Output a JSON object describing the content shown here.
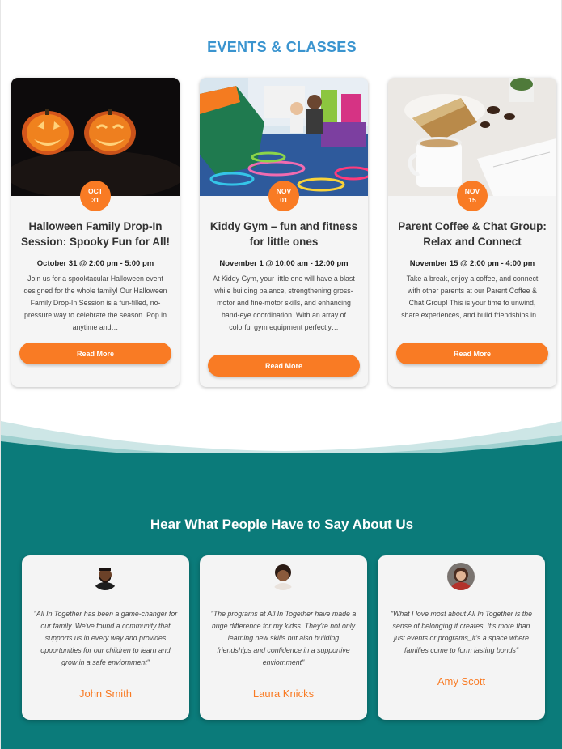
{
  "events": {
    "title": "EVENTS & CLASSES",
    "read_more_label": "Read More",
    "items": [
      {
        "month": "OCT",
        "day": "31",
        "name": "Halloween Family Drop-In Session: Spooky Fun for All!",
        "when": "October 31 @ 2:00 pm - 5:00 pm",
        "desc": "Join us for a spooktacular Halloween event designed for the whole family! Our Halloween Family Drop-In Session is a fun-filled, no-pressure way to celebrate the season. Pop in anytime and…"
      },
      {
        "month": "NOV",
        "day": "01",
        "name": "Kiddy Gym – fun and fitness for little ones",
        "when": "November 1 @ 10:00 am - 12:00 pm",
        "desc": "At Kiddy Gym, your little one will have a blast while building balance, strengthening gross-motor and fine-motor skills, and enhancing hand-eye coordination. With an array of colorful gym equipment perfectly…"
      },
      {
        "month": "NOV",
        "day": "15",
        "name": "Parent Coffee & Chat Group: Relax and Connect",
        "when": "November 15 @ 2:00 pm - 4:00 pm",
        "desc": "Take a break, enjoy a coffee, and connect with other parents at our Parent Coffee & Chat Group! This is your time to unwind, share experiences, and build friendships in…"
      }
    ]
  },
  "testimonials": {
    "title": "Hear What People Have to Say About Us",
    "items": [
      {
        "quote": "\"All In Together has been a game-changer for our family. We've found a community that supports us in every way and provides opportunities for our children to learn and grow in a safe enviornment\"",
        "name": "John Smith"
      },
      {
        "quote": "\"The programs at All In Together have made a huge difference for my kidss. They're not only learning new skills but also building friendships and confidence in a supportive enviornment\"",
        "name": "Laura Knicks"
      },
      {
        "quote": "\"What I love most about All In Together is the sense of belonging it creates. It's more than just events or programs_it's a space where families come to form lasting bonds\"",
        "name": "Amy Scott"
      }
    ]
  },
  "colors": {
    "accent": "#f97b24",
    "title_blue": "#3a94cf",
    "teal": "#0b7b7a"
  }
}
